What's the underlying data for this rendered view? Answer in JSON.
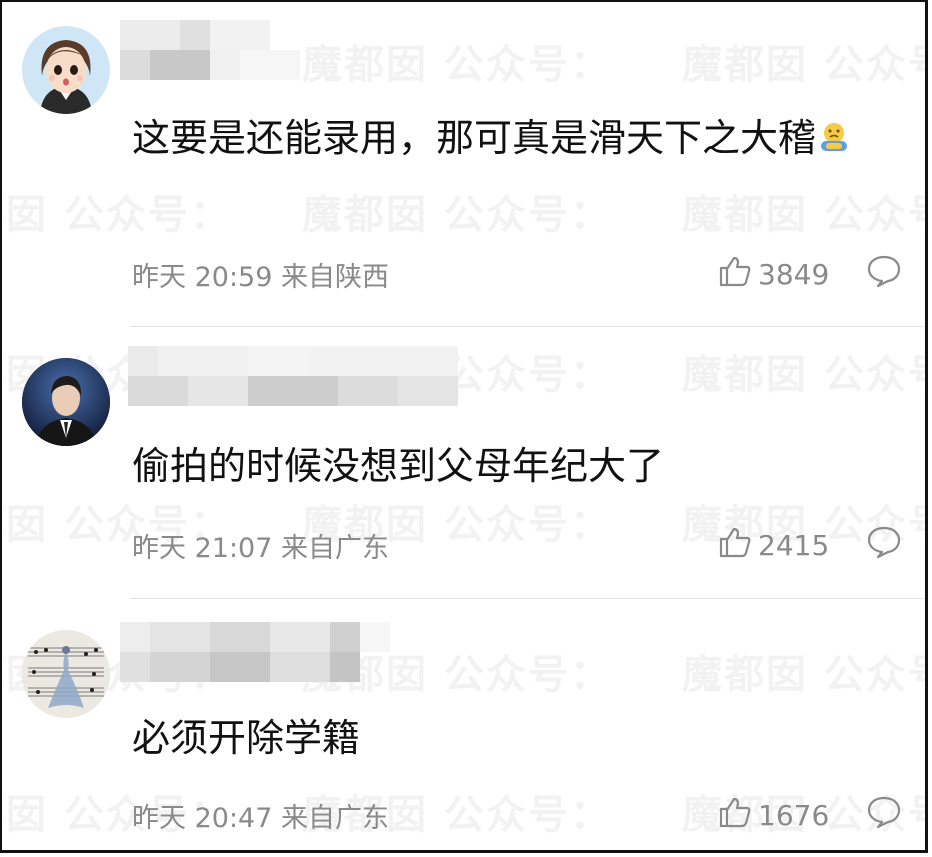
{
  "watermark": "魔都囡 公众号：",
  "comments": [
    {
      "text": "这要是还能录用，那可真是滑天下之大稽",
      "time": "昨天 20:59",
      "location": "来自陕西",
      "likes": "3849"
    },
    {
      "text": "偷拍的时候没想到父母年纪大了",
      "time": "昨天 21:07",
      "location": "来自广东",
      "likes": "2415"
    },
    {
      "text": "必须开除学籍",
      "time": "昨天 20:47",
      "location": "来自广东",
      "likes": "1676"
    }
  ],
  "icons": {
    "like": "thumbs-up-icon",
    "reply": "comment-bubble-icon",
    "emoji": "emoji-icon"
  },
  "colors": {
    "text": "#111111",
    "meta": "#8a8a8a",
    "divider": "#e2e2e2"
  }
}
